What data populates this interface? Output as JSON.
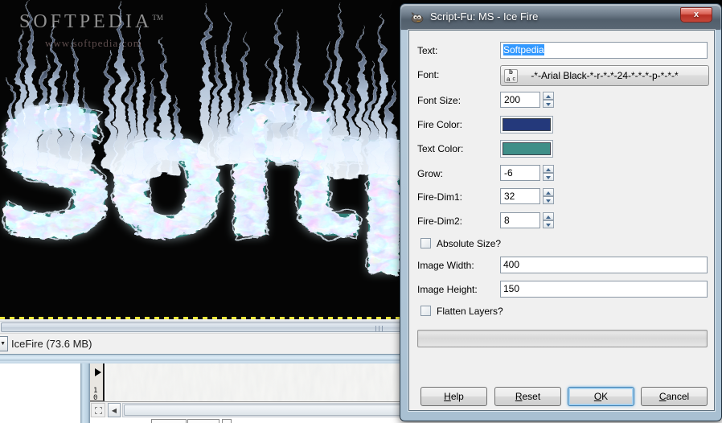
{
  "canvas": {
    "watermark_brand": "SOFTPEDIA",
    "watermark_tm": "TM",
    "watermark_url": "www.softpedia.com",
    "ice_text": "Softp",
    "ice_text_full_word": "Softpedia"
  },
  "front_window": {
    "status_text": "IceFire (73.6 MB)"
  },
  "back_window": {
    "ruler_digits": [
      "1",
      "0"
    ]
  },
  "dialog": {
    "title": "Script-Fu: MS - Ice Fire",
    "close_label": "x",
    "text_field": {
      "label": "Text:",
      "value": "Softpedia",
      "selected": true
    },
    "font": {
      "label": "Font:",
      "value": "-*-Arial Black-*-r-*-*-24-*-*-*-p-*-*-*",
      "icon_letters": [
        "a",
        "c",
        "b"
      ]
    },
    "font_size": {
      "label": "Font Size:",
      "value": "200"
    },
    "fire_color": {
      "label": "Fire Color:",
      "color": "#24397b"
    },
    "text_color": {
      "label": "Text Color:",
      "color": "#3f8f88"
    },
    "grow": {
      "label": "Grow:",
      "value": "-6"
    },
    "fire_dim1": {
      "label": "Fire-Dim1:",
      "value": "32"
    },
    "fire_dim2": {
      "label": "Fire-Dim2:",
      "value": "8"
    },
    "absolute_size": {
      "label": "Absolute Size?",
      "checked": false
    },
    "image_width": {
      "label": "Image Width:",
      "value": "400"
    },
    "image_height": {
      "label": "Image Height:",
      "value": "150"
    },
    "flatten_layers": {
      "label": "Flatten Layers?",
      "checked": false
    },
    "progress_value": "",
    "buttons": {
      "help": {
        "key": "H",
        "rest": "elp"
      },
      "reset": {
        "key": "R",
        "rest": "eset"
      },
      "ok": {
        "key": "O",
        "rest": "K"
      },
      "cancel": {
        "key": "C",
        "rest": "ancel"
      }
    }
  },
  "colors": {
    "selection_blue": "#3399ff",
    "fire_swatch": "#24397b",
    "text_swatch": "#3f8f88",
    "canvas_background": "#050505"
  }
}
